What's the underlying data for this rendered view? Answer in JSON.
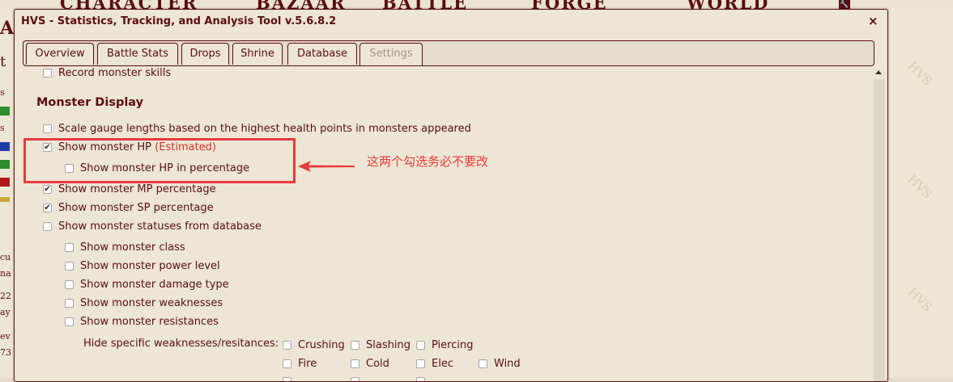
{
  "background": {
    "nav_items": [
      "CHARACTER",
      "BAZAAR",
      "BATTLE",
      "FORGE",
      "WORLD"
    ],
    "left_fragments": [
      "A",
      "t",
      "s",
      "s",
      "cu",
      "na",
      "22",
      "ay",
      "ev",
      "73"
    ],
    "right_fragment": "HVS"
  },
  "dialog": {
    "title": "HVS - Statistics, Tracking, and Analysis Tool v.5.6.8.2",
    "close_label": "×",
    "tabs": [
      {
        "label": "Overview",
        "active": false
      },
      {
        "label": "Battle Stats",
        "active": false
      },
      {
        "label": "Drops",
        "active": false
      },
      {
        "label": "Shrine",
        "active": false
      },
      {
        "label": "Database",
        "active": false
      },
      {
        "label": "Settings",
        "active": true
      }
    ]
  },
  "settings": {
    "record_skills": {
      "label": "Record monster skills",
      "checked": false
    },
    "section_heading": "Monster Display",
    "scale_gauge": {
      "label": "Scale gauge lengths based on the highest health points in monsters appeared",
      "checked": false
    },
    "show_hp": {
      "label": "Show monster HP",
      "suffix": "(Estimated)",
      "checked": true
    },
    "show_hp_pct": {
      "label": "Show monster HP in percentage",
      "checked": false
    },
    "show_mp": {
      "label": "Show monster MP percentage",
      "checked": true
    },
    "show_sp": {
      "label": "Show monster SP percentage",
      "checked": true
    },
    "show_statuses": {
      "label": "Show monster statuses from database",
      "checked": false
    },
    "show_class": {
      "label": "Show monster class",
      "checked": false
    },
    "show_power": {
      "label": "Show monster power level",
      "checked": false
    },
    "show_damage": {
      "label": "Show monster damage type",
      "checked": false
    },
    "show_weak": {
      "label": "Show monster weaknesses",
      "checked": false
    },
    "show_resist": {
      "label": "Show monster resistances",
      "checked": false
    },
    "hide_label": "Hide specific weaknesses/resitances:",
    "elements": {
      "crushing": "Crushing",
      "slashing": "Slashing",
      "piercing": "Piercing",
      "fire": "Fire",
      "cold": "Cold",
      "elec": "Elec",
      "wind": "Wind"
    }
  },
  "annotation": {
    "text": "这两个勾选务必不要改",
    "color": "#e93a3a"
  },
  "colors": {
    "text": "#5c0d11",
    "panel": "#ede6d5",
    "page": "#e3dccb",
    "estimated": "#d6302a"
  }
}
